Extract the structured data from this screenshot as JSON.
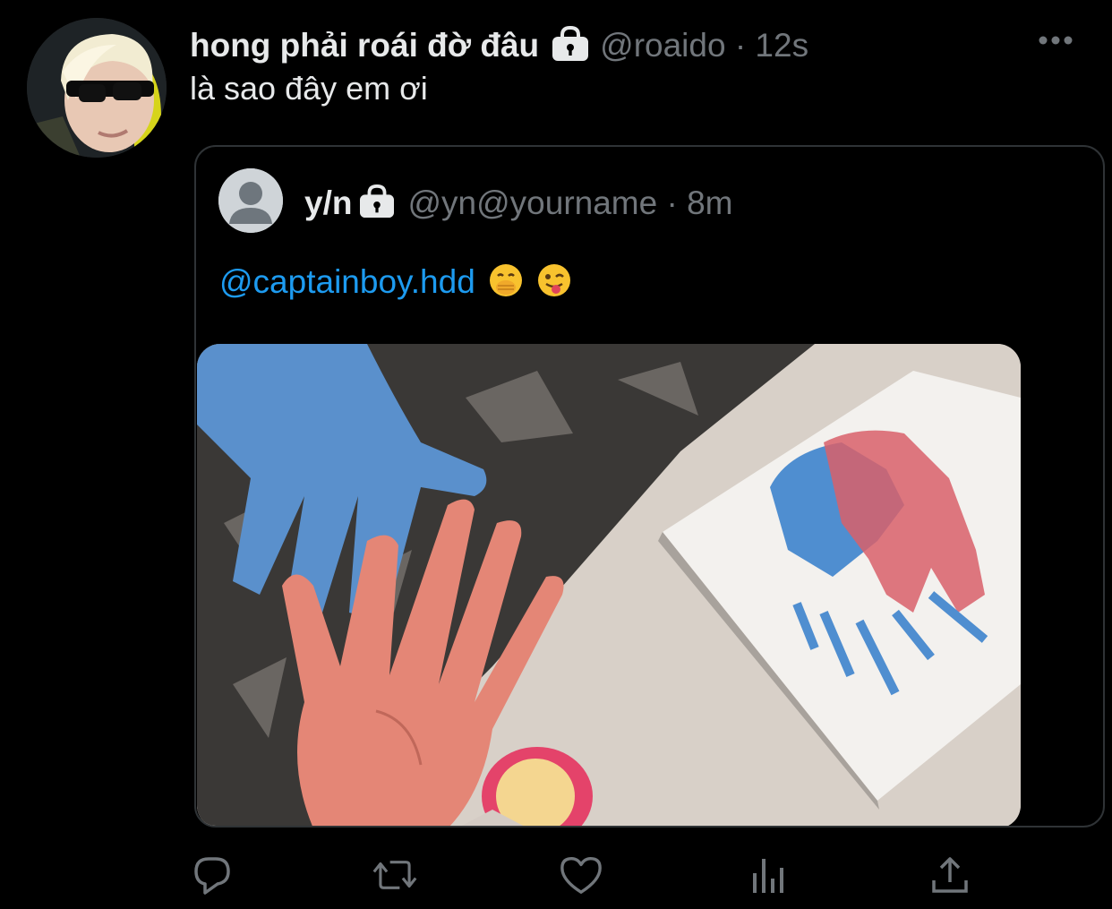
{
  "tweet": {
    "author_name": "hong phải roái đờ đâu",
    "handle_time": "@roaido · 12s",
    "text": "là sao đây em ơi",
    "more_icon": "more-horizontal-icon",
    "lock_icon": "lock-icon"
  },
  "quoted": {
    "author_name": "y/n",
    "handle_time": "@yn@yourname · 8m",
    "mention": "@captainboy.hdd",
    "emojis": [
      "face-with-hand-over-mouth",
      "winking-face-with-tongue"
    ],
    "media_alt": "photo of painted hands and handprint canvas"
  },
  "actions": [
    {
      "name": "reply-icon"
    },
    {
      "name": "retweet-icon"
    },
    {
      "name": "like-icon"
    },
    {
      "name": "analytics-icon"
    },
    {
      "name": "share-icon"
    }
  ],
  "colors": {
    "background": "#000000",
    "text": "#e7e9ea",
    "secondary": "#71767b",
    "link": "#1d9bf0",
    "border": "#2f3336"
  }
}
